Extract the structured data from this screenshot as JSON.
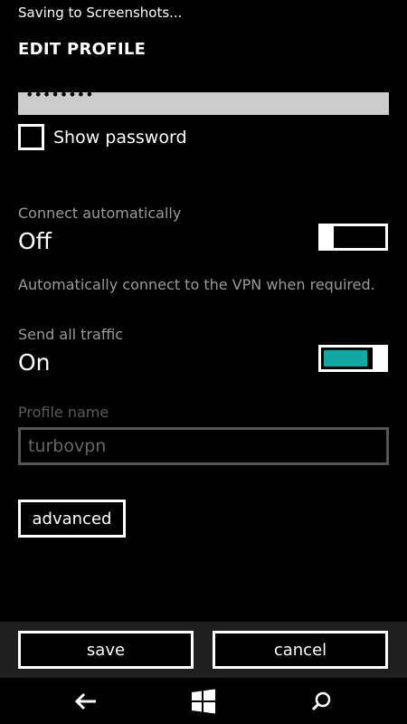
{
  "status_bar": {
    "text": "Saving to Screenshots..."
  },
  "header": {
    "title": "EDIT PROFILE"
  },
  "password": {
    "value": "••••••••"
  },
  "show_password": {
    "label": "Show password",
    "checked": false
  },
  "connect_automatically": {
    "label": "Connect automatically",
    "value": "Off",
    "enabled": false,
    "description": "Automatically connect to the VPN when required."
  },
  "send_all_traffic": {
    "label": "Send all traffic",
    "value": "On",
    "enabled": true
  },
  "profile_name": {
    "label": "Profile name",
    "value": "turbovpn"
  },
  "buttons": {
    "advanced": "advanced",
    "save": "save",
    "cancel": "cancel"
  },
  "colors": {
    "accent": "#13a6a3",
    "background": "#000000",
    "app_bar": "#1f1f1f"
  },
  "nav": {
    "icons": [
      "back-arrow-icon",
      "windows-start-icon",
      "search-icon"
    ]
  }
}
